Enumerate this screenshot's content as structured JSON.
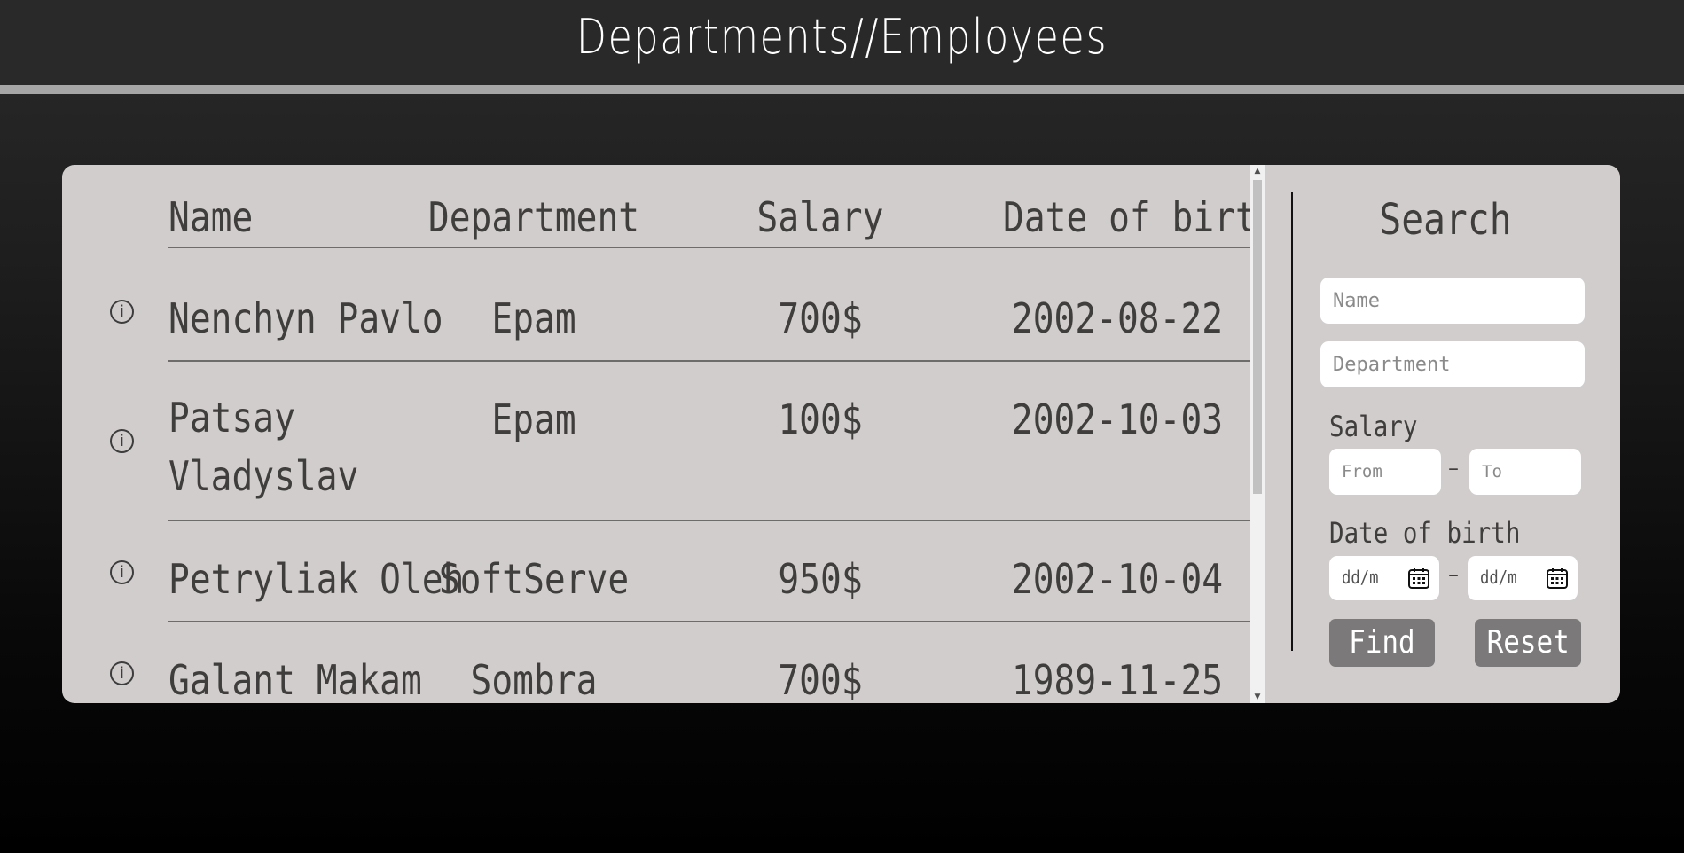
{
  "header": {
    "title": "Departments//Employees"
  },
  "table": {
    "columns": {
      "name": "Name",
      "department": "Department",
      "salary": "Salary",
      "dob": "Date of birth"
    },
    "rows": [
      {
        "name": "Nenchyn Pavlo",
        "department": "Epam",
        "salary": "700$",
        "dob": "2002-08-22",
        "info_icon": "info-icon"
      },
      {
        "name": "Patsay Vladyslav",
        "department": "Epam",
        "salary": "100$",
        "dob": "2002-10-03",
        "info_icon": "info-icon"
      },
      {
        "name": "Petryliak Oleh",
        "department": "SoftServe",
        "salary": "950$",
        "dob": "2002-10-04",
        "info_icon": "info-icon"
      },
      {
        "name": "Galant Makam",
        "department": "Sombra",
        "salary": "700$",
        "dob": "1989-11-25",
        "info_icon": "info-icon"
      }
    ]
  },
  "search": {
    "title": "Search",
    "name_placeholder": "Name",
    "department_placeholder": "Department",
    "salary_label": "Salary",
    "salary_from_placeholder": "From",
    "salary_to_placeholder": "To",
    "range_separator": "–",
    "dob_label": "Date of birth",
    "date_from_placeholder": "dd/m",
    "date_to_placeholder": "dd/m",
    "find_label": "Find",
    "reset_label": "Reset"
  },
  "colors": {
    "panel_bg": "#d1cdcd",
    "button_bg": "#7b7979",
    "text": "#403d3d",
    "header_bar": "#292929",
    "header_line": "#a6a6a6"
  }
}
